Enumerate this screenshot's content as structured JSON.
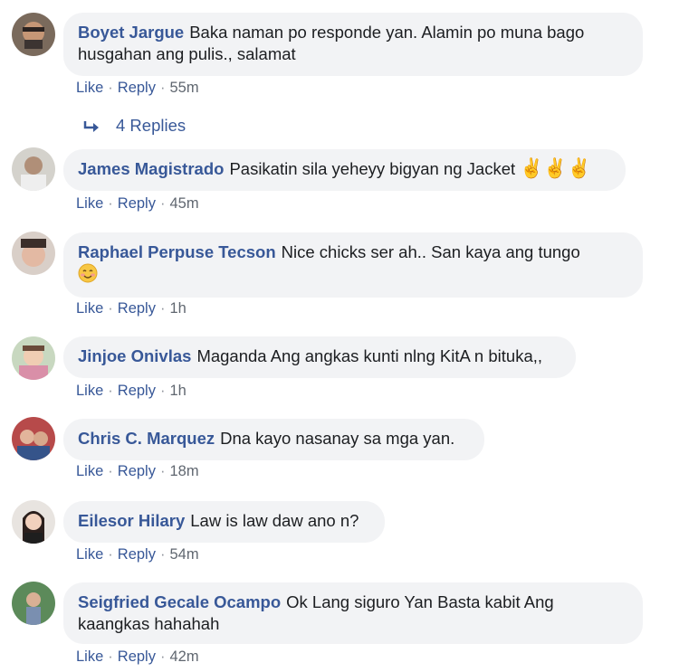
{
  "comments": [
    {
      "author": "Boyet Jargue",
      "text": "Baka naman po responde yan. Alamin po muna bago husgahan ang pulis., salamat",
      "like": "Like",
      "reply": "Reply",
      "time": "55m"
    },
    {
      "author": "James Magistrado",
      "text": "Pasikatin sila yeheyy bigyan ng Jacket",
      "emoji": "✌✌✌",
      "like": "Like",
      "reply": "Reply",
      "time": "45m"
    },
    {
      "author": "Raphael Perpuse Tecson",
      "text": "Nice chicks ser ah.. San kaya ang tungo",
      "like": "Like",
      "reply": "Reply",
      "time": "1h"
    },
    {
      "author": "Jinjoe Onivlas",
      "text": "Maganda Ang angkas kunti nlng KitA n bituka,,",
      "like": "Like",
      "reply": "Reply",
      "time": "1h"
    },
    {
      "author": "Chris C. Marquez",
      "text": "Dna kayo nasanay sa mga yan.",
      "like": "Like",
      "reply": "Reply",
      "time": "18m"
    },
    {
      "author": "Eilesor Hilary",
      "text": "Law is law daw ano n?",
      "like": "Like",
      "reply": "Reply",
      "time": "54m"
    },
    {
      "author": "Seigfried Gecale Ocampo",
      "text": "Ok Lang siguro Yan Basta kabit Ang kaangkas hahahah",
      "like": "Like",
      "reply": "Reply",
      "time": "42m"
    }
  ],
  "replies_link": "4 Replies",
  "colors": {
    "link": "#385898",
    "bubble": "#f2f3f5",
    "meta": "#606770"
  },
  "icons": {
    "replies": "reply-arrow-icon",
    "smile": "smiling-face-emoji"
  }
}
